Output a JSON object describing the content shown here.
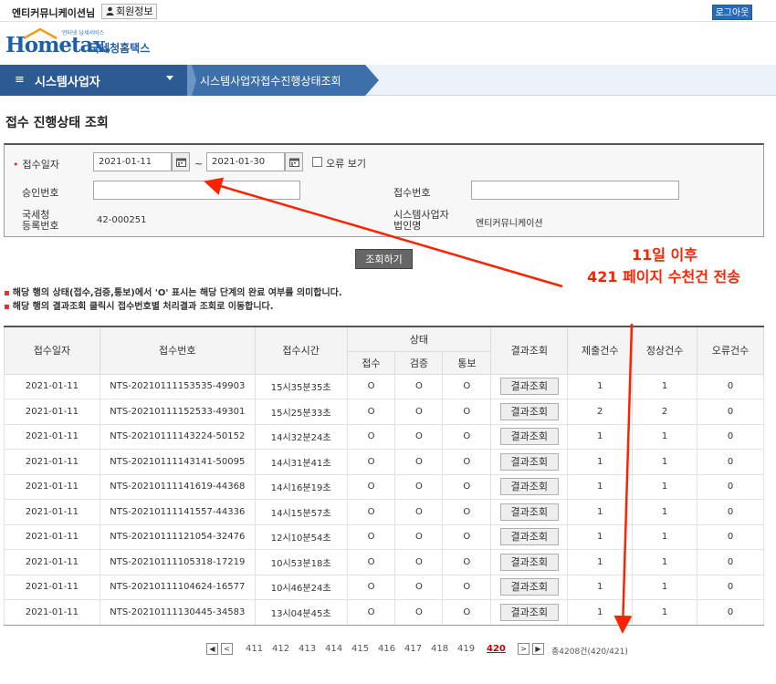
{
  "topbar": {
    "user_name": "엔티커뮤니케이션님",
    "member_info_label": "회원정보",
    "logout_label": "로그아웃"
  },
  "logo": {
    "subtitle": "언터넷 납세서비스",
    "brand": "Hometax.",
    "brand_kr": "국세청홈택스"
  },
  "nav": {
    "menu_icon": "≡",
    "menu_title": "시스템사업자",
    "breadcrumb": "시스템사업자접수진행상태조회"
  },
  "page_title": "접수 진행상태 조회",
  "search": {
    "date_label": "접수일자",
    "date_from": "2021-01-11",
    "date_to": "2021-01-30",
    "tilde": "~",
    "error_view_label": "오류 보기",
    "approval_label": "승인번호",
    "approval_value": "",
    "receipt_label": "접수번호",
    "receipt_value": "",
    "reg_label_1": "국세청",
    "reg_label_2": "등록번호",
    "reg_value": "42-000251",
    "corp_label_1": "시스템사업자",
    "corp_label_2": "법인명",
    "corp_value": "엔티커뮤니케이션",
    "search_button": "조회하기"
  },
  "annotation": {
    "line1": "11일 이후",
    "line2": "421 페이지 수천건 전송",
    "color": "#ff2200"
  },
  "notes": [
    "해당 행의 상태(접수,검증,통보)에서 'O' 표시는 해당 단계의 완료 여부를 의미합니다.",
    "해당 행의 결과조회 클릭시 접수번호별 처리결과 조회로 이동합니다."
  ],
  "table": {
    "headers": {
      "date": "접수일자",
      "receipt_no": "접수번호",
      "time": "접수시간",
      "status": "상태",
      "status_receive": "접수",
      "status_verify": "검증",
      "status_notify": "통보",
      "result": "결과조회",
      "submitted": "제출건수",
      "normal": "정상건수",
      "error": "오류건수"
    },
    "result_button": "결과조회",
    "rows": [
      {
        "date": "2021-01-11",
        "no": "NTS-20210111153535-49903",
        "time": "15시35분35초",
        "s1": "O",
        "s2": "O",
        "s3": "O",
        "sub": "1",
        "ok": "1",
        "err": "0"
      },
      {
        "date": "2021-01-11",
        "no": "NTS-20210111152533-49301",
        "time": "15시25분33초",
        "s1": "O",
        "s2": "O",
        "s3": "O",
        "sub": "2",
        "ok": "2",
        "err": "0"
      },
      {
        "date": "2021-01-11",
        "no": "NTS-20210111143224-50152",
        "time": "14시32분24초",
        "s1": "O",
        "s2": "O",
        "s3": "O",
        "sub": "1",
        "ok": "1",
        "err": "0"
      },
      {
        "date": "2021-01-11",
        "no": "NTS-20210111143141-50095",
        "time": "14시31분41초",
        "s1": "O",
        "s2": "O",
        "s3": "O",
        "sub": "1",
        "ok": "1",
        "err": "0"
      },
      {
        "date": "2021-01-11",
        "no": "NTS-20210111141619-44368",
        "time": "14시16분19초",
        "s1": "O",
        "s2": "O",
        "s3": "O",
        "sub": "1",
        "ok": "1",
        "err": "0"
      },
      {
        "date": "2021-01-11",
        "no": "NTS-20210111141557-44336",
        "time": "14시15분57초",
        "s1": "O",
        "s2": "O",
        "s3": "O",
        "sub": "1",
        "ok": "1",
        "err": "0"
      },
      {
        "date": "2021-01-11",
        "no": "NTS-20210111121054-32476",
        "time": "12시10분54초",
        "s1": "O",
        "s2": "O",
        "s3": "O",
        "sub": "1",
        "ok": "1",
        "err": "0"
      },
      {
        "date": "2021-01-11",
        "no": "NTS-20210111105318-17219",
        "time": "10시53분18초",
        "s1": "O",
        "s2": "O",
        "s3": "O",
        "sub": "1",
        "ok": "1",
        "err": "0"
      },
      {
        "date": "2021-01-11",
        "no": "NTS-20210111104624-16577",
        "time": "10시46분24초",
        "s1": "O",
        "s2": "O",
        "s3": "O",
        "sub": "1",
        "ok": "1",
        "err": "0"
      },
      {
        "date": "2021-01-11",
        "no": "NTS-20210111130445-34583",
        "time": "13시04분45초",
        "s1": "O",
        "s2": "O",
        "s3": "O",
        "sub": "1",
        "ok": "1",
        "err": "0"
      }
    ]
  },
  "pager": {
    "prev_first": "◀",
    "prev": "<",
    "pages": [
      "411",
      "412",
      "413",
      "414",
      "415",
      "416",
      "417",
      "418",
      "419",
      "420"
    ],
    "active_page": "420",
    "next": ">",
    "next_last": "▶",
    "total_text": "총4208건(420/421)"
  }
}
